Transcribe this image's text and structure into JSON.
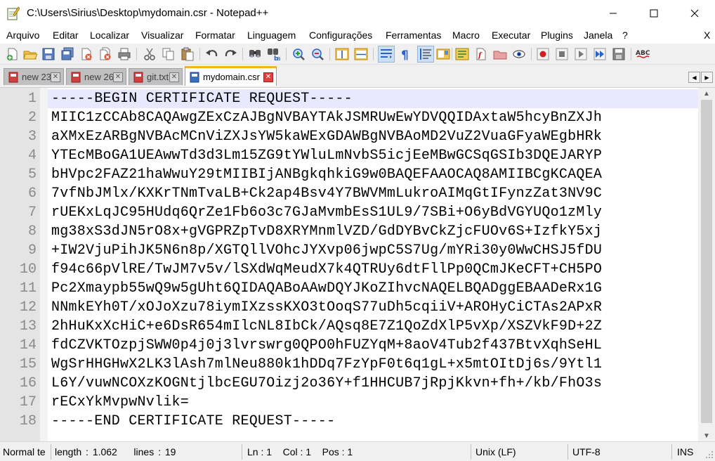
{
  "window": {
    "title": "C:\\Users\\Sirius\\Desktop\\mydomain.csr - Notepad++",
    "app_icon": "notepad-plus-plus-icon",
    "controls": [
      "minimize-icon",
      "maximize-icon",
      "close-icon"
    ]
  },
  "menu": {
    "items": [
      "Arquivo",
      "Editar",
      "Localizar",
      "Visualizar",
      "Formatar",
      "Linguagem",
      "Configurações",
      "Ferramentas",
      "Macro",
      "Executar",
      "Plugins",
      "Janela",
      "?"
    ],
    "close_label": "X"
  },
  "toolbar": {
    "buttons": [
      "new-file-icon",
      "open-file-icon",
      "save-icon",
      "save-all-icon",
      "close-icon",
      "close-all-icon",
      "print-icon",
      "cut-icon",
      "copy-icon",
      "paste-icon",
      "undo-icon",
      "redo-icon",
      "find-icon",
      "replace-icon",
      "zoom-in-icon",
      "zoom-out-icon",
      "sync-vertical-icon",
      "sync-horizontal-icon",
      "word-wrap-icon",
      "show-all-chars-icon",
      "indent-guide-icon",
      "doc-map-icon",
      "function-list-icon",
      "folder-workspace-icon",
      "monitoring-icon",
      "doc-switcher-icon",
      "record-macro-icon",
      "stop-macro-icon",
      "play-macro-icon",
      "run-macro-multiple-icon",
      "save-macro-icon",
      "spell-check-icon"
    ]
  },
  "tabs": [
    {
      "label": "new 23",
      "active": false,
      "icon": "unsaved-file-icon"
    },
    {
      "label": "new 26",
      "active": false,
      "icon": "unsaved-file-icon"
    },
    {
      "label": "git.txt",
      "active": false,
      "icon": "unsaved-file-icon"
    },
    {
      "label": "mydomain.csr",
      "active": true,
      "icon": "saved-file-icon"
    }
  ],
  "tab_nav": [
    "scroll-left-icon",
    "scroll-right-icon"
  ],
  "editor": {
    "current_line": 1,
    "lines": [
      "-----BEGIN CERTIFICATE REQUEST-----",
      "MIIC1zCCAb8CAQAwgZExCzAJBgNVBAYTAkJSMRUwEwYDVQQIDAxtaW5hcyBnZXJh",
      "aXMxEzARBgNVBAcMCnViZXJsYW5kaWExGDAWBgNVBAoMD2VuZ2VuaGFyaWEgbHRk",
      "YTEcMBoGA1UEAwwTd3d3Lm15ZG9tYWluLmNvbS5icjEeMBwGCSqGSIb3DQEJARYP",
      "bHVpc2FAZ21haWwuY29tMIIBIjANBgkqhkiG9w0BAQEFAAOCAQ8AMIIBCgKCAQEA",
      "7vfNbJMlx/KXKrTNmTvaLB+Ck2ap4Bsv4Y7BWVMmLukroAIMqGtIFynzZat3NV9C",
      "rUEKxLqJC95HUdq6QrZe1Fb6o3c7GJaMvmbEsS1UL9/7SBi+O6yBdVGYUQo1zMly",
      "mg38xS3dJN5rO8x+gVGPRZpTvD8XRYMnmlVZD/GdDYBvCkZjcFUOv6S+IzfkY5xj",
      "+IW2VjuPihJK5N6n8p/XGTQllVOhcJYXvp06jwpC5S7Ug/mYRi30y0WwCHSJ5fDU",
      "f94c66pVlRE/TwJM7v5v/lSXdWqMeudX7k4QTRUy6dtFllPp0QCmJKeCFT+CH5PO",
      "Pc2Xmaypb55wQ9w5gUht6QIDAQABoAAwDQYJKoZIhvcNAQELBQADggEBAADeRx1G",
      "NNmkEYh0T/xOJoXzu78iymIXzssKXO3tOoqS77uDh5cqiiV+AROHyCiCTAs2APxR",
      "2hHuKxXcHiC+e6DsR654mIlcNL8IbCk/AQsq8E7Z1QoZdXlP5vXp/XSZVkF9D+2Z",
      "fdCZVKTOzpjSWW0p4j0j3lvrswrg0QPO0hFUZYqM+8aoV4Tub2f437BtvXqhSeHL",
      "WgSrHHGHwX2LK3lAsh7mlNeu880k1hDDq7FzYpF0t6q1gL+x5mtOItDj6s/9Ytl1",
      "L6Y/vuwNCOXzKOGNtjlbcEGU7Oizj2o36Y+f1HHCUB7jRpjKkvn+fh+/kb/FhO3s",
      "rECxYkMvpwNvlik=",
      "-----END CERTIFICATE REQUEST-----"
    ],
    "line_numbers": [
      "1",
      "2",
      "3",
      "4",
      "5",
      "6",
      "7",
      "8",
      "9",
      "10",
      "11",
      "12",
      "13",
      "14",
      "15",
      "16",
      "17",
      "18"
    ]
  },
  "scrollbar": {
    "up": "scroll-up-icon",
    "down": "scroll-down-icon"
  },
  "statusbar": {
    "language": "Normal te",
    "length": "length : 1.062",
    "lines": "lines : 19",
    "ln": "Ln : 1",
    "col": "Col : 1",
    "pos": "Pos : 1",
    "eol": "Unix (LF)",
    "encoding": "UTF-8",
    "mode": "INS"
  }
}
